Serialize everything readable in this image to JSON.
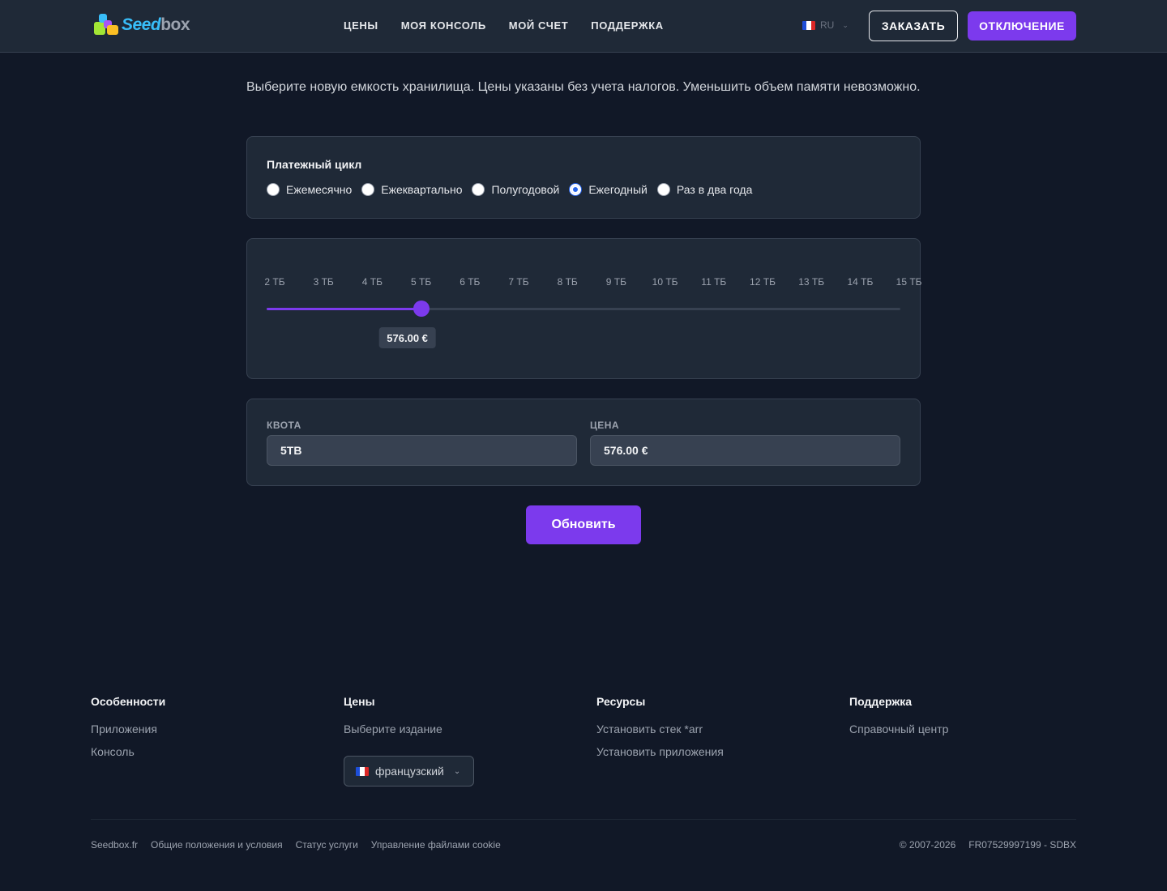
{
  "header": {
    "logo_text_a": "Seed",
    "logo_text_b": "box",
    "nav": [
      "ЦЕНЫ",
      "МОЯ КОНСОЛЬ",
      "МОЙ СЧЕТ",
      "ПОДДЕРЖКА"
    ],
    "language": "RU",
    "order_label": "ЗАКАЗАТЬ",
    "logout_label": "ОТКЛЮЧЕНИЕ"
  },
  "intro": "Выберите новую емкость хранилища. Цены указаны без учета налогов. Уменьшить объем памяти невозможно.",
  "billing": {
    "title": "Платежный цикл",
    "options": [
      "Ежемесячно",
      "Ежеквартально",
      "Полугодовой",
      "Ежегодный",
      "Раз в два года"
    ],
    "selected": "Ежегодный"
  },
  "slider": {
    "ticks": [
      "2 ТБ",
      "3 ТБ",
      "4 ТБ",
      "5 ТБ",
      "6 ТБ",
      "7 ТБ",
      "8 ТБ",
      "9 ТБ",
      "10 ТБ",
      "11 ТБ",
      "12 ТБ",
      "13 ТБ",
      "14 ТБ",
      "15 ТБ"
    ],
    "selected_tick": "5 ТБ",
    "tooltip": "576.00 €"
  },
  "fields": {
    "quota_label": "КВОТА",
    "quota_value": "5TB",
    "price_label": "ЦЕНА",
    "price_value": "576.00 €"
  },
  "update_label": "Обновить",
  "footer": {
    "features": {
      "title": "Особенности",
      "links": [
        "Приложения",
        "Консоль"
      ]
    },
    "pricing": {
      "title": "Цены",
      "links": [
        "Выберите издание"
      ]
    },
    "resources": {
      "title": "Ресурсы",
      "links": [
        "Установить стек *arr",
        "Установить приложения"
      ]
    },
    "support": {
      "title": "Поддержка",
      "links": [
        "Справочный центр"
      ]
    },
    "language_select": "французский",
    "legal": [
      "Seedbox.fr",
      "Общие положения и условия",
      "Статус услуги",
      "Управление файлами cookie"
    ],
    "copyright": "© 2007-2026",
    "company_id": "FR07529997199 - SDBX"
  },
  "colors": {
    "accent": "#7c3aed",
    "background": "#111827",
    "card": "#1f2937"
  }
}
